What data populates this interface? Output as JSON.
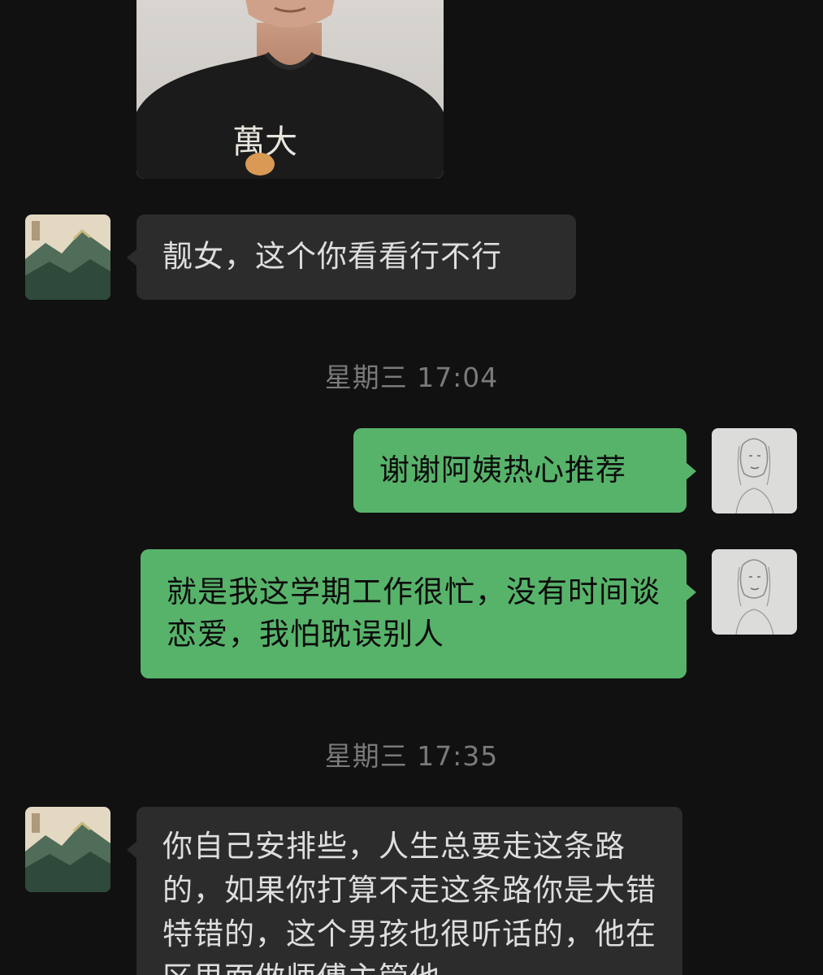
{
  "photo_message": {
    "shirt_text": "萬大"
  },
  "messages": [
    {
      "text": "靓女，这个你看看行不行"
    },
    {
      "text": "谢谢阿姨热心推荐"
    },
    {
      "text": "就是我这学期工作很忙，没有时间谈恋爱，我怕耽误别人"
    },
    {
      "text": "你自己安排些，人生总要走这条路的，如果你打算不走这条路你是大错特错的，这个男孩也很听话的，他在区里面做师傅主管他"
    }
  ],
  "timestamps": [
    "星期三 17:04",
    "星期三 17:35"
  ],
  "colors": {
    "background": "#111111",
    "incoming_bubble": "#2c2c2c",
    "outgoing_bubble": "#57b36a",
    "timestamp_text": "#7a7a7a"
  },
  "icons": {
    "incoming_avatar": "landscape-painting-avatar",
    "outgoing_avatar": "pencil-sketch-portrait-avatar"
  }
}
